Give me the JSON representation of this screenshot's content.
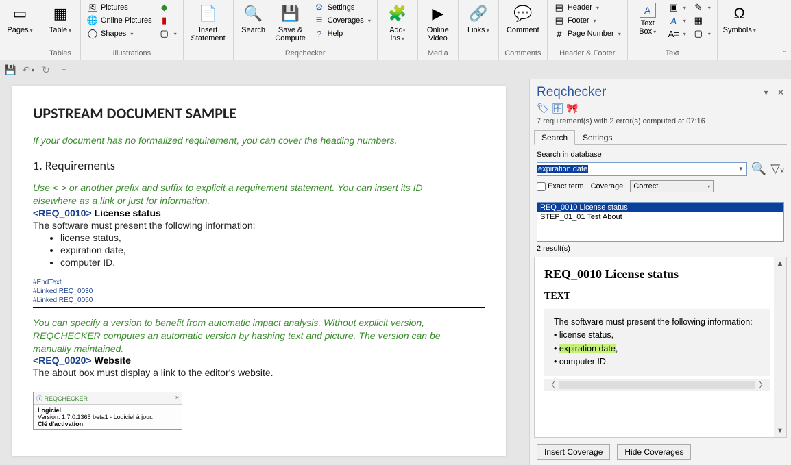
{
  "ribbon": {
    "pages": "Pages",
    "tables_group": "Tables",
    "table": "Table",
    "illus_group": "Illustrations",
    "pictures": "Pictures",
    "online_pictures": "Online Pictures",
    "shapes": "Shapes",
    "insert_stmt_group": "",
    "insert_stmt": "Insert Statement",
    "reqchecker_group": "Reqchecker",
    "search": "Search",
    "save_compute": "Save & Compute",
    "settings": "Settings",
    "coverages": "Coverages",
    "help": "Help",
    "addins_group": "",
    "addins": "Add-ins",
    "media_group": "Media",
    "online_video": "Online Video",
    "links_group": "",
    "links": "Links",
    "comments_group": "Comments",
    "comment": "Comment",
    "hf_group": "Header & Footer",
    "header": "Header",
    "footer": "Footer",
    "page_number": "Page Number",
    "text_group": "Text",
    "text_box": "Text Box",
    "symbols_group": "",
    "symbols": "Symbols"
  },
  "doc": {
    "title": "UPSTREAM DOCUMENT SAMPLE",
    "intro": "If your document has no formalized requirement, you can cover the heading numbers.",
    "h_req": "1.  Requirements",
    "hint1a": "Use < > or another prefix and suffix to explicit a requirement statement. You can insert its ID",
    "hint1b": "elsewhere as a link or just for information.",
    "req1_tag": "<REQ_0010>",
    "req1_title": " License status",
    "req1_body": "The software must present the following information:",
    "req1_li1": "license status,",
    "req1_li2": "expiration date,",
    "req1_li3": "computer ID.",
    "meta_end": "#EndText",
    "meta_l1": "#Linked REQ_0030",
    "meta_l2": "#Linked REQ_0050",
    "hint2a": "You can specify a version to benefit from automatic impact analysis. Without explicit version,",
    "hint2b": "REQCHECKER computes an automatic version by hashing text and picture. The version can be",
    "hint2c": "manually maintained.",
    "req2_tag": "<REQ_0020>",
    "req2_title": " Website",
    "req2_body": "The about box must display a link to the editor's website.",
    "dlg_title": "REQCHECKER",
    "dlg_l1": "Logiciel",
    "dlg_l2": "Version: 1.7.0.1365 beta1 -  Logiciel à jour.",
    "dlg_l3": "Clé d'activation"
  },
  "panel": {
    "title": "Reqchecker",
    "status": "7 requirement(s) with 2 error(s) computed at 07:16",
    "tab_search": "Search",
    "tab_settings": "Settings",
    "search_label": "Search in database",
    "search_value": "expiration date",
    "exact_term": "Exact term",
    "coverage_lbl": "Coverage",
    "coverage_val": "Correct",
    "res1": "REQ_0010 License status",
    "res2": "STEP_01_01 Test About",
    "res_count": "2 result(s)",
    "detail_title": "REQ_0010 License status",
    "detail_h4": "TEXT",
    "detail_line1": "The software must present the following information:",
    "detail_b1": "• license status,",
    "detail_b2a": "• ",
    "detail_b2_hl": "expiration date",
    "detail_b2b": ",",
    "detail_b3": "• computer ID.",
    "btn_insert": "Insert Coverage",
    "btn_hide": "Hide Coverages"
  }
}
